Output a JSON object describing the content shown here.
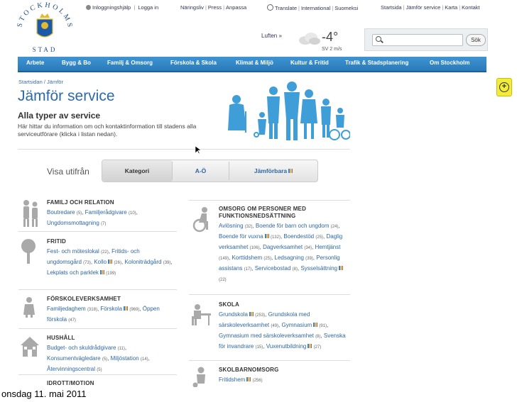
{
  "caption": "onsdag 11. mai 2011",
  "logo": {
    "text": "STOCKHOLMS STAD"
  },
  "toplinks": {
    "help": "Inloggningshjälp",
    "login": "Logga in",
    "naringsliv": "Näringsliv",
    "press": "Press",
    "anpassa": "Anpassa",
    "translate": "Translate",
    "international": "International",
    "suomeksi": "Suomeksi",
    "startsida": "Startsida",
    "jamfor": "Jämför service",
    "karta": "Karta",
    "kontakt": "Kontakt"
  },
  "weather": {
    "label": "Luften »",
    "temp": "-4°",
    "wind": "SV 2 m/s"
  },
  "search": {
    "button": "Sök",
    "placeholder": ""
  },
  "nav": [
    "Arbete",
    "Bygg & Bo",
    "Familj & Omsorg",
    "Förskola & Skola",
    "Klimat & Miljö",
    "Kultur & Fritid",
    "Trafik & Stadsplanering",
    "Om Stockholm"
  ],
  "breadcrumb": "Startsidan / Jämför",
  "title": "Jämför service",
  "subtitle": "Alla typer av service",
  "intro": "Här hittar du information om och kontaktinformation till stadens alla serviceutförare (klicka i listan nedan).",
  "visa": "Visa utifrån",
  "tabs": [
    "Kategori",
    "A-Ö",
    "Jämförbara"
  ],
  "categories_left": [
    {
      "heading": "FAMILJ OCH RELATION",
      "links": [
        [
          "Boutredare",
          "(5)"
        ],
        [
          "Familjerådgivare",
          "(10)"
        ],
        [
          "Ungdomsmottagning",
          "(7)"
        ]
      ]
    },
    {
      "heading": "FRITID",
      "links": [
        [
          "Fest- och möteslokal",
          "(22)"
        ],
        [
          "Fritids- och ungdomsgård",
          "(73)"
        ],
        [
          "Kollo",
          "(26)"
        ],
        [
          "Koloniträdgård",
          "(39)"
        ],
        [
          "Lekplats och parklek",
          "(199)"
        ]
      ]
    },
    {
      "heading": "FÖRSKOLEVERKSAMHET",
      "links": [
        [
          "Familjedaghem",
          "(318)"
        ],
        [
          "Förskola",
          "(969)"
        ],
        [
          "Öppen förskola",
          "(47)"
        ]
      ]
    },
    {
      "heading": "HUSHÅLL",
      "links": [
        [
          "Budget- och skuldrådgivare",
          "(11)"
        ],
        [
          "Konsumentvägledare",
          "(5)"
        ],
        [
          "Miljöstation",
          "(14)"
        ],
        [
          "Återvinningscentral",
          "(5)"
        ]
      ]
    },
    {
      "heading": "IDROTT/MOTION",
      "links": []
    }
  ],
  "categories_right": [
    {
      "heading": "OMSORG OM PERSONER MED FUNKTIONSNEDSÄTTNING",
      "links": [
        [
          "Avlösning",
          "(32)"
        ],
        [
          "Boende för barn och ungdom",
          "(24)"
        ],
        [
          "Boende för vuxna",
          "(132)"
        ],
        [
          "Boendestöd",
          "(25)"
        ],
        [
          "Daglig verksamhet",
          "(106)"
        ],
        [
          "Dagverksamhet",
          "(34)"
        ],
        [
          "Hemtjänst",
          "(149)"
        ],
        [
          "Korttidshem",
          "(25)"
        ],
        [
          "Ledsagning",
          "(39)"
        ],
        [
          "Personlig assistans",
          "(17)"
        ],
        [
          "Servicebostad",
          "(8)"
        ],
        [
          "Sysselsättning",
          "(22)"
        ]
      ]
    },
    {
      "heading": "SKOLA",
      "links": [
        [
          "Grundskola",
          "(253)"
        ],
        [
          "Grundskola med särskoleverksamhet",
          "(49)"
        ],
        [
          "Gymnasium",
          "(91)"
        ],
        [
          "Gymnasium med särskoleverksamhet",
          "(8)"
        ],
        [
          "Svenska för invandrare",
          "(15)"
        ],
        [
          "Vuxenutbildning",
          "(27)"
        ]
      ]
    },
    {
      "heading": "SKOLBARNOMSORG",
      "links": [
        [
          "Fritidshem",
          "(256)"
        ]
      ]
    }
  ]
}
